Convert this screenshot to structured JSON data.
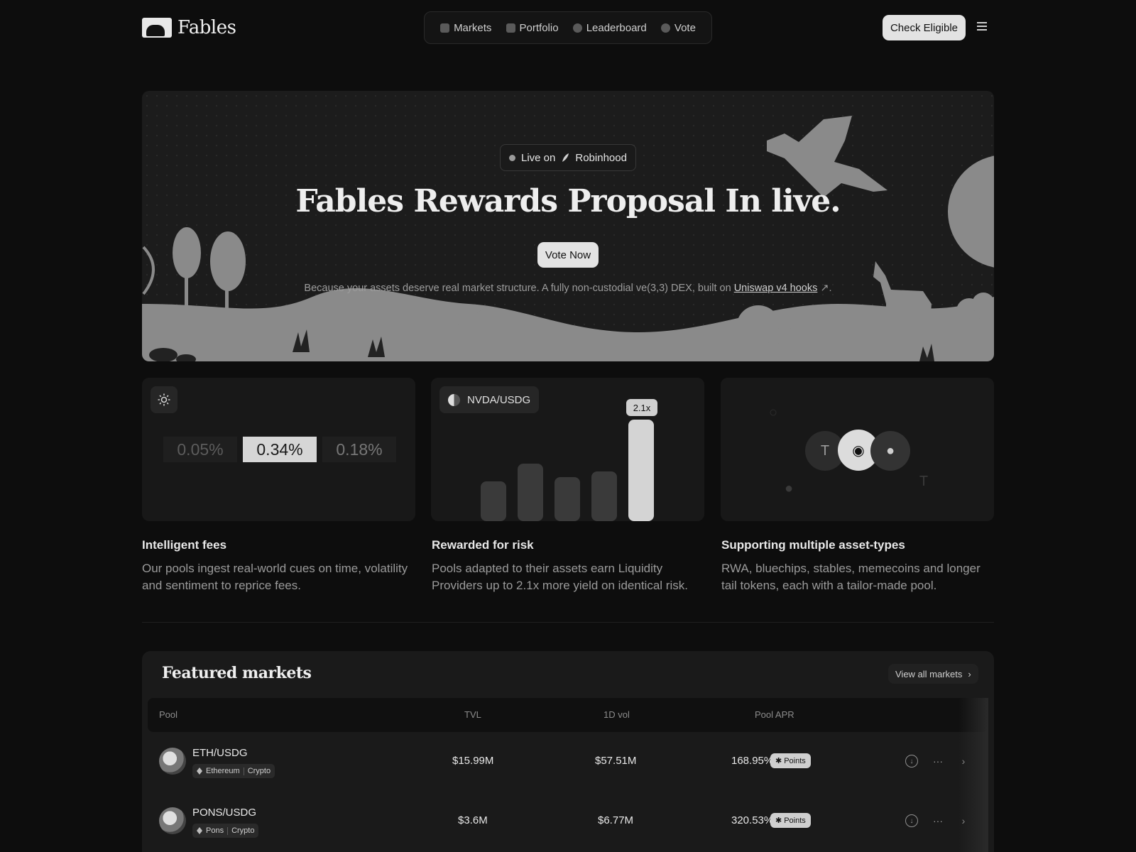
{
  "brand": {
    "name": "Fables"
  },
  "nav": {
    "items": [
      {
        "label": "Markets",
        "icon": "cube-icon"
      },
      {
        "label": "Portfolio",
        "icon": "wallet-icon"
      },
      {
        "label": "Leaderboard",
        "icon": "medal-icon"
      },
      {
        "label": "Vote",
        "icon": "gauge-icon"
      }
    ],
    "cta": "Check Eligible"
  },
  "hero": {
    "badge_prefix": "Live on",
    "badge_brand": "Robinhood",
    "title": "Fables Rewards Proposal In live.",
    "button": "Vote Now",
    "subtitle": "Because your assets deserve real market structure. A fully non-custodial ve(3,3) DEX, built on ",
    "link": "Uniswap v4 hooks",
    "subtitle_end": "."
  },
  "features": [
    {
      "title": "Intelligent fees",
      "desc": "Our pools ingest real-world cues on time, volatility and sentiment to reprice fees.",
      "fees": [
        "0.05%",
        "0.34%",
        "0.18%"
      ]
    },
    {
      "title": "Rewarded for risk",
      "desc": "Pools adapted to their assets earn Liquidity Providers up to 2.1x more yield on identical risk.",
      "pair": "NVDA/USDG",
      "highlight": "2.1x"
    },
    {
      "title": "Supporting multiple asset-types",
      "desc": "RWA, bluechips, stables, memecoins and longer tail tokens, each with a tailor-made pool."
    }
  ],
  "markets": {
    "title": "Featured markets",
    "view_all": "View all markets",
    "columns": [
      "Pool",
      "TVL",
      "1D vol",
      "Pool APR"
    ],
    "rows": [
      {
        "pool": "ETH/USDG",
        "chain": "Ethereum",
        "category": "Crypto",
        "tvl": "$15.99M",
        "vol": "$57.51M",
        "apr": "168.95%",
        "badge": "Points"
      },
      {
        "pool": "PONS/USDG",
        "chain": "Pons",
        "category": "Crypto",
        "tvl": "$3.6M",
        "vol": "$6.77M",
        "apr": "320.53%",
        "badge": "Points"
      }
    ]
  }
}
